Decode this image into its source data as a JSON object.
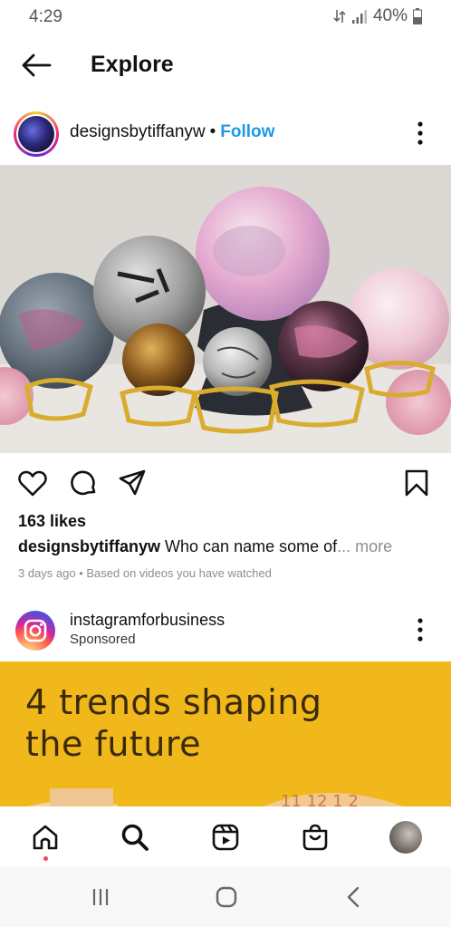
{
  "status_bar": {
    "time": "4:29",
    "battery": "40%"
  },
  "header": {
    "title": "Explore",
    "back_icon": "arrow-left-icon"
  },
  "post": {
    "username": "designsbytiffanyw",
    "separator": "•",
    "follow_label": "Follow",
    "likes": "163 likes",
    "caption_user": "designsbytiffanyw",
    "caption_text": " Who can name some of",
    "caption_more": "... more",
    "meta": "3 days ago • Based on videos you have watched",
    "image_alt": "crystal spheres on gold stands"
  },
  "ad": {
    "account": "instagramforbusiness",
    "sponsored": "Sponsored",
    "headline_line1": "4 trends shaping",
    "headline_line2": "the future"
  },
  "bottom_nav": {
    "items": [
      "home-icon",
      "search-icon",
      "reels-icon",
      "shop-icon",
      "profile-avatar"
    ]
  },
  "system_nav": {
    "items": [
      "recents-icon",
      "home-circle-icon",
      "back-chevron-icon"
    ]
  },
  "colors": {
    "follow_blue": "#1f98ea",
    "ad_yellow": "#f1b81b",
    "notification_red": "#ed4956"
  }
}
